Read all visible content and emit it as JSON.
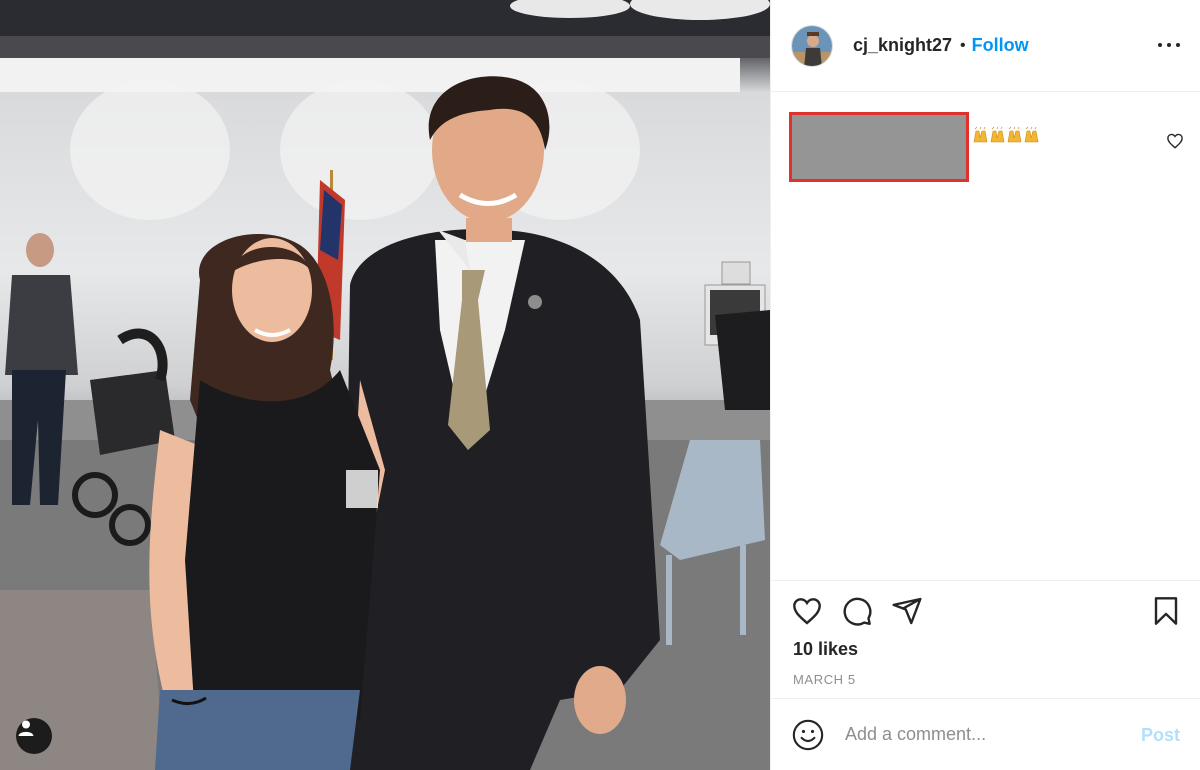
{
  "post": {
    "username": "cj_knight27",
    "separator": "•",
    "follow_label": "Follow",
    "caption_emoji": [
      "🙌",
      "🙌",
      "🙌",
      "🙌"
    ],
    "likes": "10 likes",
    "date": "MARCH 5"
  },
  "comment": {
    "placeholder": "Add a comment...",
    "post_label": "Post"
  },
  "icons": {
    "more": "more-options-icon",
    "heart": "heart-icon",
    "comment": "comment-icon",
    "share": "share-icon",
    "bookmark": "bookmark-icon",
    "smiley": "smiley-icon",
    "user_tag": "user-tag-icon"
  },
  "colors": {
    "follow": "#0095f6",
    "post_disabled": "#b2dffc",
    "redaction_border": "#e0322c",
    "redaction_fill": "#959595"
  }
}
